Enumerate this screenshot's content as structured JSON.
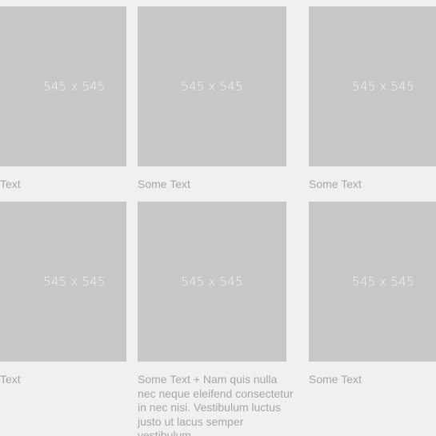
{
  "grid": {
    "cards": [
      {
        "image_label": "545 x 545",
        "caption": "Text"
      },
      {
        "image_label": "545 x 545",
        "caption": "Some Text"
      },
      {
        "image_label": "545 x 545",
        "caption": "Some Text"
      },
      {
        "image_label": "545 x 545",
        "caption": "Text"
      },
      {
        "image_label": "545 x 545",
        "caption": "Some Text + Nam quis nulla nec neque eleifend consectetur in nec nisi. Vestibulum luctus justo ut lacus semper vestibulum."
      },
      {
        "image_label": "545 x 545",
        "caption": "Some Text"
      }
    ]
  },
  "colors": {
    "background": "#f0f0f0",
    "placeholder": "#c7c7c7",
    "placeholder_text": "#f4f4f4",
    "caption_text": "#a6a6a6"
  }
}
